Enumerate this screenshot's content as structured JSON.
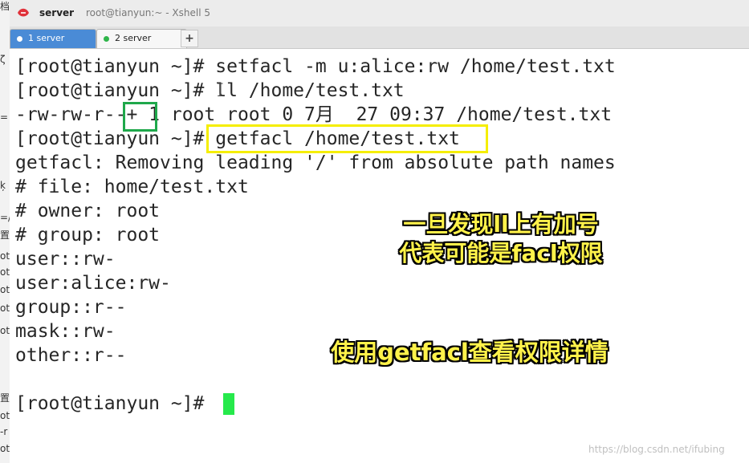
{
  "window": {
    "app_name": "server",
    "title": "root@tianyun:~ - Xshell 5",
    "app_icon": "xshell-logo-icon"
  },
  "tabs": [
    {
      "label": "1 server",
      "active": true,
      "status_color": "#ffffff"
    },
    {
      "label": "2 server",
      "active": false,
      "status_color": "#2fb54a"
    }
  ],
  "add_tab_label": "+",
  "terminal": {
    "lines": [
      "[root@tianyun ~]# setfacl -m u:alice:rw /home/test.txt",
      "[root@tianyun ~]# ll /home/test.txt",
      "-rw-rw-r--+ 1 root root 0 7月  27 09:37 /home/test.txt",
      "[root@tianyun ~]# getfacl /home/test.txt",
      "getfacl: Removing leading '/' from absolute path names",
      "# file: home/test.txt",
      "# owner: root",
      "# group: root",
      "user::rw-",
      "user:alice:rw-",
      "group::r--",
      "mask::rw-",
      "other::r--",
      "",
      "[root@tianyun ~]# "
    ],
    "cursor_color": "#26e94b"
  },
  "highlights": {
    "green_box_color": "#1fa84b",
    "yellow_box_color": "#f5ee00"
  },
  "annotations": {
    "line1": "一旦发现ll上有加号",
    "line2": "代表可能是facl权限",
    "line3": "使用getfacl查看权限详情"
  },
  "left_strip_fragments": [
    "档",
    "ζ",
    "=",
    "ķ",
    "=/",
    "置",
    "ot",
    "ot",
    "ot",
    "ot",
    "ot",
    "置",
    "ot",
    "-r",
    "ot"
  ],
  "watermark": "https://blog.csdn.net/ifubing"
}
